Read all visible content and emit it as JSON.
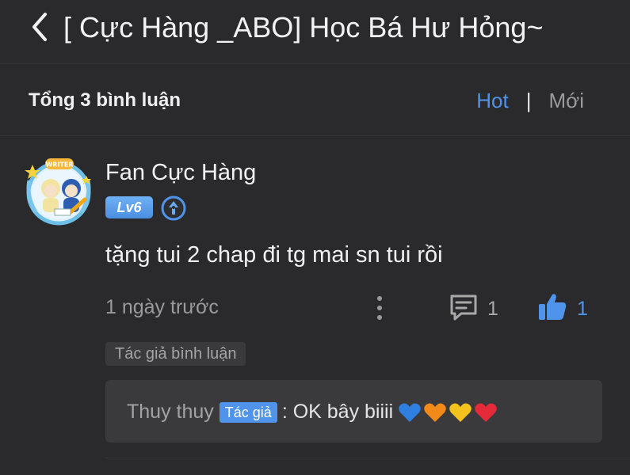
{
  "header": {
    "back_icon": "chevron-left-icon",
    "title": "[ Cực Hàng _ABO] Học Bá Hư Hỏng~"
  },
  "comments_bar": {
    "total_label": "Tổng 3 bình luận",
    "sort_hot": "Hot",
    "sort_separator": "|",
    "sort_new": "Mới",
    "active_color": "#4f94ea"
  },
  "comment": {
    "username": "Fan Cực Hàng",
    "avatar_badge_text": "WRITER",
    "level": "Lv6",
    "writer_icon": "pen-nib-badge-icon",
    "text": "tặng tui 2 chap đi tg mai sn tui rồi",
    "time": "1 ngày trước",
    "more_icon": "more-vertical-icon",
    "reply_icon": "comment-icon",
    "reply_count": "1",
    "like_icon": "thumbs-up-icon",
    "like_count": "1",
    "author_tag": "Tác giả bình luận"
  },
  "reply": {
    "name": "Thuy thuy",
    "badge": "Tác giả",
    "text": ": OK bây biiii",
    "hearts": [
      "blue-heart",
      "orange-heart",
      "yellow-heart",
      "red-heart"
    ],
    "heart_colors": [
      "#2f7fe0",
      "#f28a1a",
      "#f4c21c",
      "#e52b3a"
    ]
  }
}
